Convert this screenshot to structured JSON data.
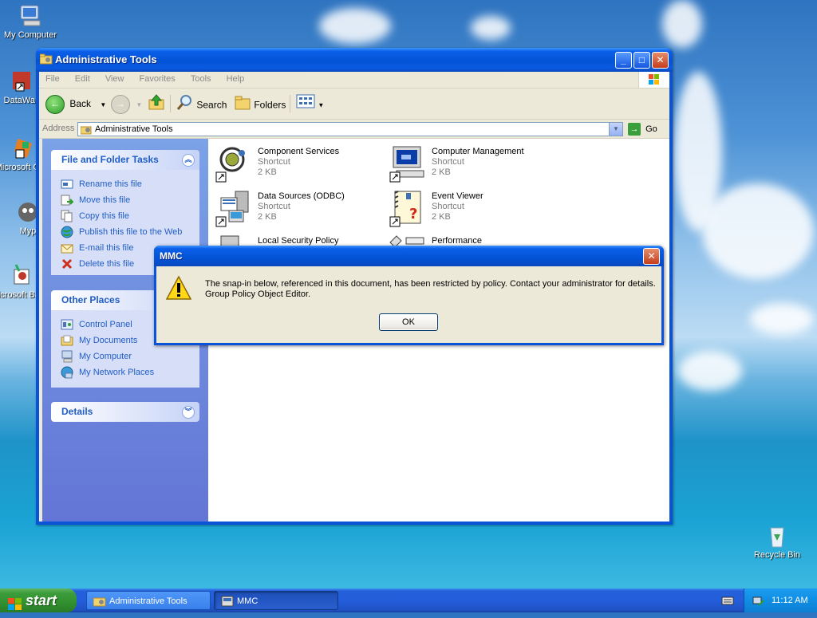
{
  "desktop": {
    "icons": [
      {
        "label": "My Computer"
      },
      {
        "label": "DataWa"
      },
      {
        "label": "Microsoft C++"
      },
      {
        "label": "Myp"
      },
      {
        "label": "Microsoft Basic"
      },
      {
        "label": "Recycle Bin"
      }
    ]
  },
  "window": {
    "title": "Administrative Tools",
    "menu": [
      "File",
      "Edit",
      "View",
      "Favorites",
      "Tools",
      "Help"
    ],
    "toolbar": {
      "back_label": "Back",
      "search_label": "Search",
      "folders_label": "Folders"
    },
    "address": {
      "label": "Address",
      "value": "Administrative Tools",
      "go_label": "Go"
    },
    "left_pane": {
      "file_tasks": {
        "title": "File and Folder Tasks",
        "items": [
          "Rename this file",
          "Move this file",
          "Copy this file",
          "Publish this file to the Web",
          "E-mail this file",
          "Delete this file"
        ]
      },
      "other_places": {
        "title": "Other Places",
        "items": [
          "Control Panel",
          "My Documents",
          "My Computer",
          "My Network Places"
        ]
      },
      "details": {
        "title": "Details"
      }
    },
    "files": [
      {
        "name": "Component Services",
        "type": "Shortcut",
        "size": "2 KB"
      },
      {
        "name": "Computer Management",
        "type": "Shortcut",
        "size": "2 KB"
      },
      {
        "name": "Data Sources (ODBC)",
        "type": "Shortcut",
        "size": "2 KB"
      },
      {
        "name": "Event Viewer",
        "type": "Shortcut",
        "size": "2 KB"
      },
      {
        "name": "Local Security Policy",
        "type": "",
        "size": ""
      },
      {
        "name": "Performance",
        "type": "",
        "size": ""
      }
    ]
  },
  "dialog": {
    "title": "MMC",
    "message_line1": "The snap-in below, referenced in this document, has been restricted by policy. Contact your administrator for details.",
    "message_line2": "Group Policy Object Editor.",
    "ok_label": "OK"
  },
  "taskbar": {
    "start_label": "start",
    "tasks": [
      {
        "label": "Administrative Tools"
      },
      {
        "label": "MMC"
      }
    ],
    "clock": "11:12 AM"
  },
  "icons": {
    "warning": "warning-icon",
    "close": "close-icon",
    "minimize": "minimize-icon",
    "maximize": "maximize-icon"
  }
}
